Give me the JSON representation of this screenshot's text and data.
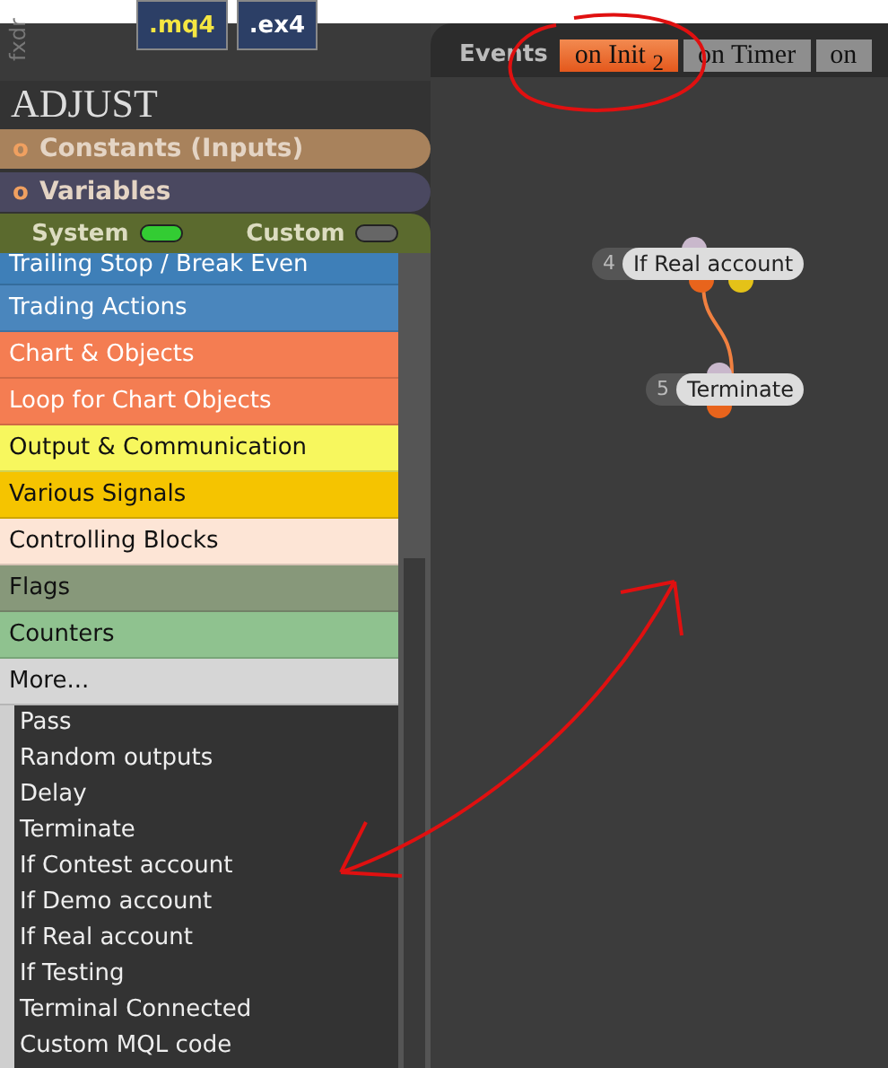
{
  "sidebar_label": "fxdr",
  "file_buttons": [
    {
      "label": ".mq4"
    },
    {
      "label": ".ex4"
    }
  ],
  "panel_title": "ADJUST",
  "sections": [
    {
      "bullet": "o",
      "label": "Constants (Inputs)",
      "color": "#a8825c"
    },
    {
      "bullet": "o",
      "label": "Variables",
      "color": "#4a4860"
    }
  ],
  "toggles": [
    {
      "label": "System",
      "on": true
    },
    {
      "label": "Custom",
      "on": false
    }
  ],
  "categories": [
    {
      "label": "Trailing Stop / Break Even",
      "color": "#3e7fb8"
    },
    {
      "label": "Trading Actions",
      "color": "#4a86bd"
    },
    {
      "label": "Chart & Objects",
      "color": "#f47d52"
    },
    {
      "label": "Loop for Chart Objects",
      "color": "#f47d52"
    },
    {
      "label": "Output & Communication",
      "color": "#f7f75e"
    },
    {
      "label": "Various Signals",
      "color": "#f5c400"
    },
    {
      "label": "Controlling Blocks",
      "color": "#fde5d6"
    },
    {
      "label": "Flags",
      "color": "#87987a"
    },
    {
      "label": "Counters",
      "color": "#8fc28f"
    },
    {
      "label": "More...",
      "color": "#d6d6d6"
    }
  ],
  "blocks": [
    "Pass",
    "Random outputs",
    "Delay",
    "Terminate",
    "If Contest account",
    "If Demo account",
    "If Real account",
    "If Testing",
    "Terminal Connected",
    "Custom MQL code"
  ],
  "events_label": "Events",
  "tabs": [
    {
      "label": "on Init $_{2}$",
      "selected": true
    },
    {
      "label": "on Timer",
      "selected": false
    },
    {
      "label": "on",
      "selected": false
    }
  ],
  "nodes": [
    {
      "number": "4",
      "label": "If Real account"
    },
    {
      "number": "5",
      "label": "Terminate"
    }
  ]
}
